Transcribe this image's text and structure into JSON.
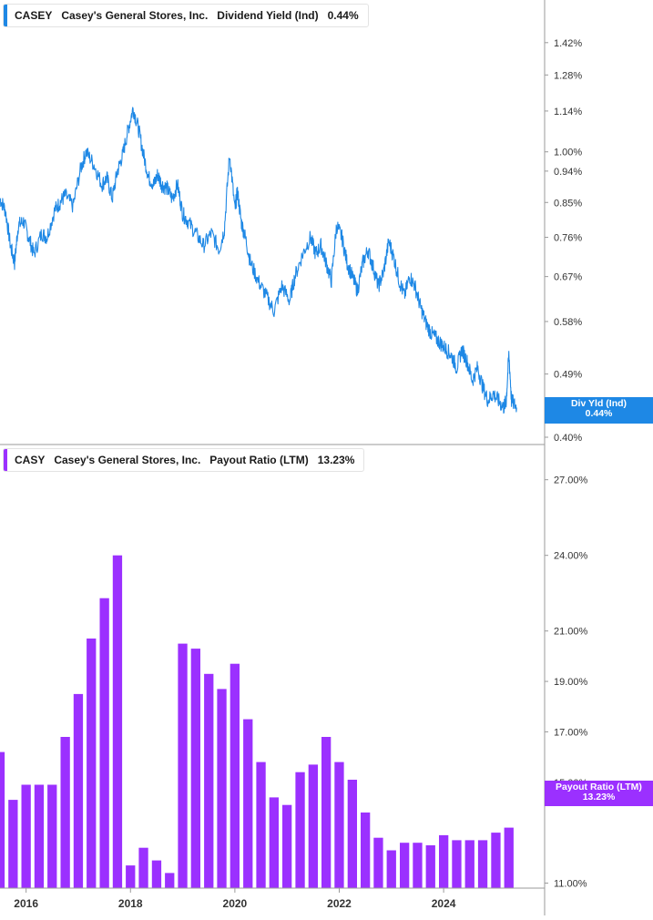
{
  "colors": {
    "yield_line": "#1e88e5",
    "payout_bar": "#9b30ff",
    "yield_tag": "#1e88e5",
    "payout_tag": "#9b30ff",
    "grid": "#c8c8c8",
    "text": "#333333"
  },
  "panels": {
    "top": {
      "ticker": "CASEY",
      "company": "Casey's General Stores, Inc.",
      "metric": "Dividend Yield (Ind)",
      "value": "0.44%",
      "tag_label": "Div Yld (Ind)",
      "tag_value": "0.44%"
    },
    "bottom": {
      "ticker": "CASY",
      "company": "Casey's General Stores, Inc.",
      "metric": "Payout Ratio (LTM)",
      "value": "13.23%",
      "tag_label": "Payout Ratio (LTM)",
      "tag_value": "13.23%"
    }
  },
  "chart_data": [
    {
      "type": "line",
      "title": "CASY Casey's General Stores, Inc. Dividend Yield (Ind) 0.44%",
      "scale": "log",
      "y_ticks": [
        "1.42%",
        "1.28%",
        "1.14%",
        "1.00%",
        "0.94%",
        "0.85%",
        "0.76%",
        "0.67%",
        "0.58%",
        "0.49%",
        "0.40%"
      ],
      "y_tick_values": [
        1.42,
        1.28,
        1.14,
        1.0,
        0.94,
        0.85,
        0.76,
        0.67,
        0.58,
        0.49,
        0.4
      ],
      "ylim": [
        0.4,
        1.6
      ],
      "xlim": [
        2015.5,
        2025.9
      ],
      "series": [
        {
          "name": "Dividend Yield (Ind)",
          "x": [
            2015.5,
            2015.6,
            2015.7,
            2015.78,
            2015.85,
            2015.95,
            2016.05,
            2016.15,
            2016.3,
            2016.4,
            2016.55,
            2016.65,
            2016.75,
            2016.9,
            2017.05,
            2017.15,
            2017.3,
            2017.45,
            2017.55,
            2017.65,
            2017.75,
            2017.85,
            2017.95,
            2018.05,
            2018.15,
            2018.25,
            2018.35,
            2018.45,
            2018.52,
            2018.6,
            2018.7,
            2018.8,
            2018.9,
            2019.0,
            2019.1,
            2019.25,
            2019.4,
            2019.55,
            2019.7,
            2019.8,
            2019.9,
            2020.0,
            2020.05,
            2020.12,
            2020.2,
            2020.3,
            2020.45,
            2020.6,
            2020.75,
            2020.9,
            2021.05,
            2021.15,
            2021.3,
            2021.45,
            2021.55,
            2021.65,
            2021.75,
            2021.85,
            2021.95,
            2022.05,
            2022.15,
            2022.25,
            2022.35,
            2022.45,
            2022.55,
            2022.65,
            2022.75,
            2022.85,
            2022.95,
            2023.05,
            2023.15,
            2023.25,
            2023.35,
            2023.45,
            2023.55,
            2023.65,
            2023.75,
            2023.85,
            2023.95,
            2024.05,
            2024.15,
            2024.25,
            2024.35,
            2024.45,
            2024.55,
            2024.65,
            2024.75,
            2024.85,
            2024.95,
            2025.05,
            2025.15,
            2025.2,
            2025.25,
            2025.3,
            2025.4
          ],
          "values": [
            0.86,
            0.83,
            0.74,
            0.7,
            0.79,
            0.8,
            0.76,
            0.72,
            0.77,
            0.76,
            0.83,
            0.85,
            0.87,
            0.84,
            0.95,
            1.0,
            0.96,
            0.9,
            0.92,
            0.86,
            0.94,
            0.99,
            1.07,
            1.15,
            1.08,
            0.99,
            0.92,
            0.9,
            0.93,
            0.9,
            0.89,
            0.86,
            0.9,
            0.82,
            0.8,
            0.77,
            0.74,
            0.77,
            0.73,
            0.78,
            0.99,
            0.83,
            0.88,
            0.8,
            0.76,
            0.7,
            0.66,
            0.63,
            0.6,
            0.65,
            0.62,
            0.67,
            0.72,
            0.76,
            0.72,
            0.74,
            0.7,
            0.66,
            0.79,
            0.76,
            0.7,
            0.67,
            0.64,
            0.7,
            0.73,
            0.69,
            0.65,
            0.68,
            0.75,
            0.71,
            0.66,
            0.63,
            0.67,
            0.65,
            0.61,
            0.58,
            0.56,
            0.55,
            0.54,
            0.53,
            0.52,
            0.5,
            0.53,
            0.51,
            0.48,
            0.5,
            0.47,
            0.45,
            0.46,
            0.45,
            0.44,
            0.45,
            0.52,
            0.45,
            0.44
          ]
        }
      ]
    },
    {
      "type": "bar",
      "title": "CASY Casey's General Stores, Inc. Payout Ratio (LTM) 13.23%",
      "y_ticks": [
        "27.00%",
        "24.00%",
        "21.00%",
        "19.00%",
        "17.00%",
        "15.00%",
        "11.00%"
      ],
      "y_tick_values": [
        27,
        24,
        21,
        19,
        17,
        15,
        11
      ],
      "ylim": [
        10.8,
        28.0
      ],
      "xlim": [
        2015.5,
        2025.9
      ],
      "x_ticks": [
        "2016",
        "2018",
        "2020",
        "2022",
        "2024"
      ],
      "x_tick_values": [
        2016,
        2018,
        2020,
        2022,
        2024
      ],
      "series": [
        {
          "name": "Payout Ratio (LTM)",
          "x": [
            2015.5,
            2015.75,
            2016.0,
            2016.25,
            2016.5,
            2016.75,
            2017.0,
            2017.25,
            2017.5,
            2017.75,
            2018.0,
            2018.25,
            2018.5,
            2018.75,
            2019.0,
            2019.25,
            2019.5,
            2019.75,
            2020.0,
            2020.25,
            2020.5,
            2020.75,
            2021.0,
            2021.25,
            2021.5,
            2021.75,
            2022.0,
            2022.25,
            2022.5,
            2022.75,
            2023.0,
            2023.25,
            2023.5,
            2023.75,
            2024.0,
            2024.25,
            2024.5,
            2024.75,
            2025.0,
            2025.25
          ],
          "values": [
            16.2,
            14.3,
            14.9,
            14.9,
            14.9,
            16.8,
            18.5,
            20.7,
            22.3,
            24.0,
            11.7,
            12.4,
            11.9,
            11.4,
            20.5,
            20.3,
            19.3,
            18.7,
            19.7,
            17.5,
            15.8,
            14.4,
            14.1,
            15.4,
            15.7,
            16.8,
            15.8,
            15.1,
            13.8,
            12.8,
            12.3,
            12.6,
            12.6,
            12.5,
            12.9,
            12.7,
            12.7,
            12.7,
            13.0,
            13.2
          ]
        }
      ]
    }
  ]
}
